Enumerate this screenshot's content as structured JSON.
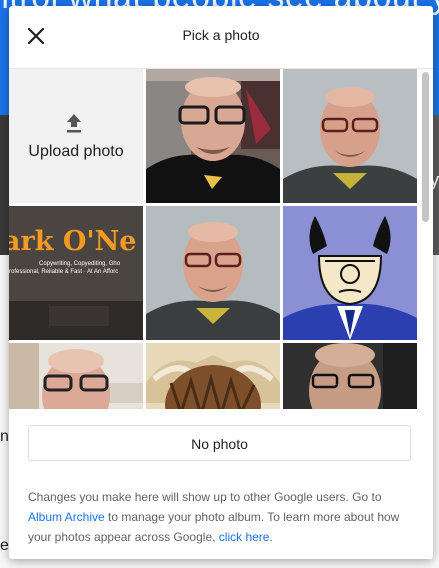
{
  "background": {
    "banner_text": "ntrol what people see about y",
    "left_letters": [
      "n",
      "e"
    ],
    "right_letter": "y",
    "colors": {
      "banner": "#1a73e8"
    }
  },
  "dialog": {
    "title": "Pick a photo",
    "close_icon": "close-icon",
    "upload": {
      "icon": "upload-icon",
      "label": "Upload photo"
    },
    "photos": [
      {
        "name": "photo-selfie-glasses-black-tshirt"
      },
      {
        "name": "photo-portrait-grey-background"
      },
      {
        "name": "photo-banner-mark-oneill"
      },
      {
        "name": "photo-portrait-grey-background-2"
      },
      {
        "name": "photo-cartoon-manager"
      },
      {
        "name": "photo-webcam-selfie"
      },
      {
        "name": "photo-highland-cow"
      },
      {
        "name": "photo-dark-portrait"
      }
    ],
    "banner_photo": {
      "heading": "ark O'Ne",
      "subline1": "Copywriting, Copyediting, Gho",
      "subline2": "rofessional, Reliable & Fast · At An Afforc"
    },
    "no_photo_label": "No photo",
    "footer": {
      "text_1": "Changes you make here will show up to other Google users. Go to ",
      "link_album": "Album Archive",
      "text_2": " to manage your photo album. To learn more about how your photos appear across Google, ",
      "link_click": "click here",
      "text_3": "."
    },
    "colors": {
      "link": "#1a73e8",
      "text": "#5f6368"
    }
  }
}
